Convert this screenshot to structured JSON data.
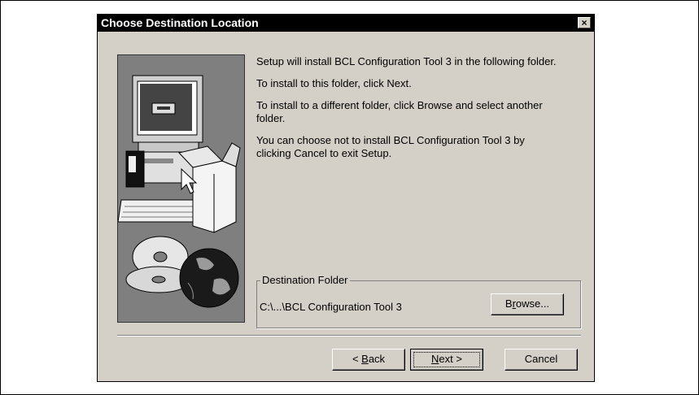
{
  "dialog": {
    "title": "Choose Destination Location",
    "close_label": "×"
  },
  "body": {
    "line1": "Setup will install BCL Configuration Tool 3 in the following folder.",
    "line2": "To install to this folder, click Next.",
    "line3a": "To install to a different folder, click Browse and select another",
    "line3b": "folder.",
    "line4a": "You can choose not to install BCL Configuration Tool 3 by",
    "line4b": "clicking Cancel to exit Setup."
  },
  "destination": {
    "group_label": "Destination Folder",
    "path": "C:\\...\\BCL Configuration Tool 3",
    "browse_pre": "B",
    "browse_acc": "r",
    "browse_post": "owse..."
  },
  "buttons": {
    "back_pre": "< ",
    "back_acc": "B",
    "back_post": "ack",
    "next_acc": "N",
    "next_post": "ext >",
    "cancel": "Cancel"
  },
  "colors": {
    "dialog_bg": "#d4d0c8",
    "titlebar_bg": "#000000",
    "art_bg": "#7f7f7f"
  }
}
